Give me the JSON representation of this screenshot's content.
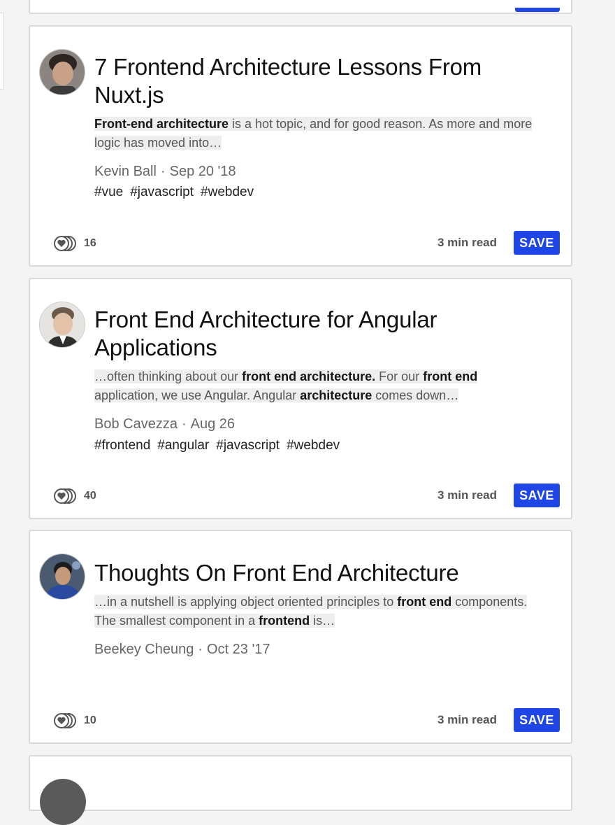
{
  "articles": [
    {
      "title": "7 Frontend Architecture Lessons From Nuxt.js",
      "snippet": [
        {
          "t": "Front-end architecture",
          "b": true
        },
        {
          "t": " is a hot topic, and for good reason. As more and more logic has moved into…",
          "b": false
        }
      ],
      "author": "Kevin Ball",
      "date": "Sep 20 '18",
      "tags": [
        "#vue",
        "#javascript",
        "#webdev"
      ],
      "reactions": "16",
      "read_time": "3 min read",
      "save_label": "SAVE"
    },
    {
      "title": "Front End Architecture for Angular Applications",
      "snippet": [
        {
          "t": "…often thinking about our ",
          "b": false
        },
        {
          "t": "front end architecture.",
          "b": true
        },
        {
          "t": " For our ",
          "b": false
        },
        {
          "t": "front end",
          "b": true
        },
        {
          "t": " application, we use Angular. Angular ",
          "b": false
        },
        {
          "t": "architecture",
          "b": true
        },
        {
          "t": " comes down…",
          "b": false
        }
      ],
      "author": "Bob Cavezza",
      "date": "Aug 26",
      "tags": [
        "#frontend",
        "#angular",
        "#javascript",
        "#webdev"
      ],
      "reactions": "40",
      "read_time": "3 min read",
      "save_label": "SAVE"
    },
    {
      "title": "Thoughts On Front End Architecture",
      "snippet": [
        {
          "t": "…in a nutshell is applying object oriented principles to ",
          "b": false
        },
        {
          "t": "front end",
          "b": true
        },
        {
          "t": " components. The smallest component in a ",
          "b": false
        },
        {
          "t": "frontend",
          "b": true
        },
        {
          "t": " is…",
          "b": false
        }
      ],
      "author": "Beekey Cheung",
      "date": "Oct 23 '17",
      "tags": [],
      "reactions": "10",
      "read_time": "3 min read",
      "save_label": "SAVE"
    }
  ],
  "colors": {
    "save_button": "#1e46e6",
    "card_border": "#d9d9d9",
    "highlight": "#eeeeee"
  },
  "icons": {
    "reaction": "hearts-icon"
  }
}
